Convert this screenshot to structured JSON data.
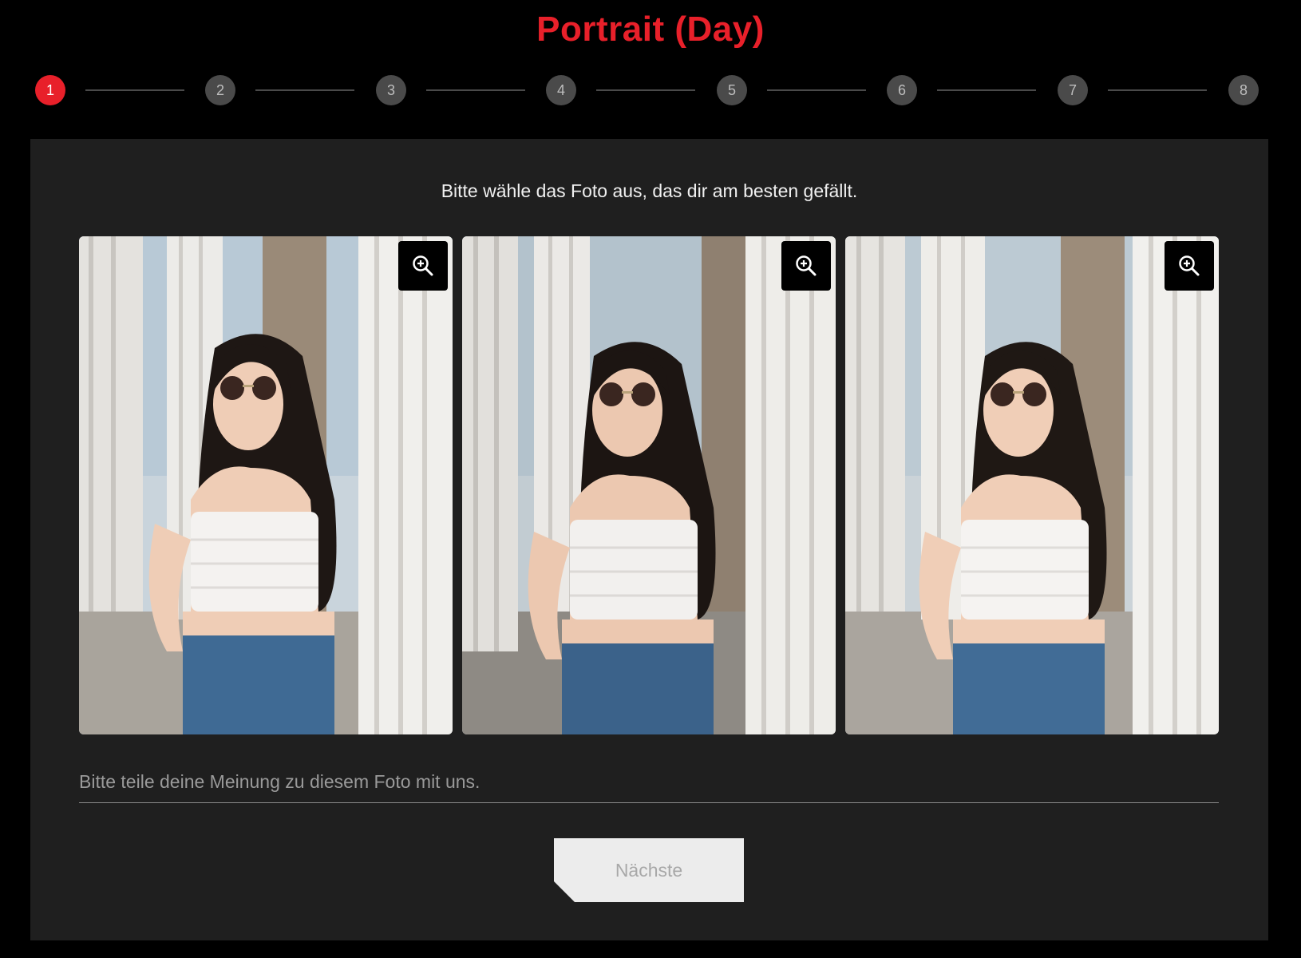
{
  "header": {
    "title": "Portrait (Day)"
  },
  "stepper": {
    "current": 1,
    "steps": [
      "1",
      "2",
      "3",
      "4",
      "5",
      "6",
      "7",
      "8"
    ],
    "colors": {
      "active": "#e8202a",
      "inactive": "#4a4a4a"
    }
  },
  "survey": {
    "instruction": "Bitte wähle das Foto aus, das dir am besten gefällt.",
    "photos": [
      {
        "zoom_icon": "zoom-in-icon"
      },
      {
        "zoom_icon": "zoom-in-icon"
      },
      {
        "zoom_icon": "zoom-in-icon"
      }
    ],
    "comment_placeholder": "Bitte teile deine Meinung zu diesem Foto mit uns.",
    "next_label": "Nächste"
  },
  "colors": {
    "accent": "#e8202a",
    "panel_bg": "#1f1f1f",
    "page_bg": "#000000"
  }
}
